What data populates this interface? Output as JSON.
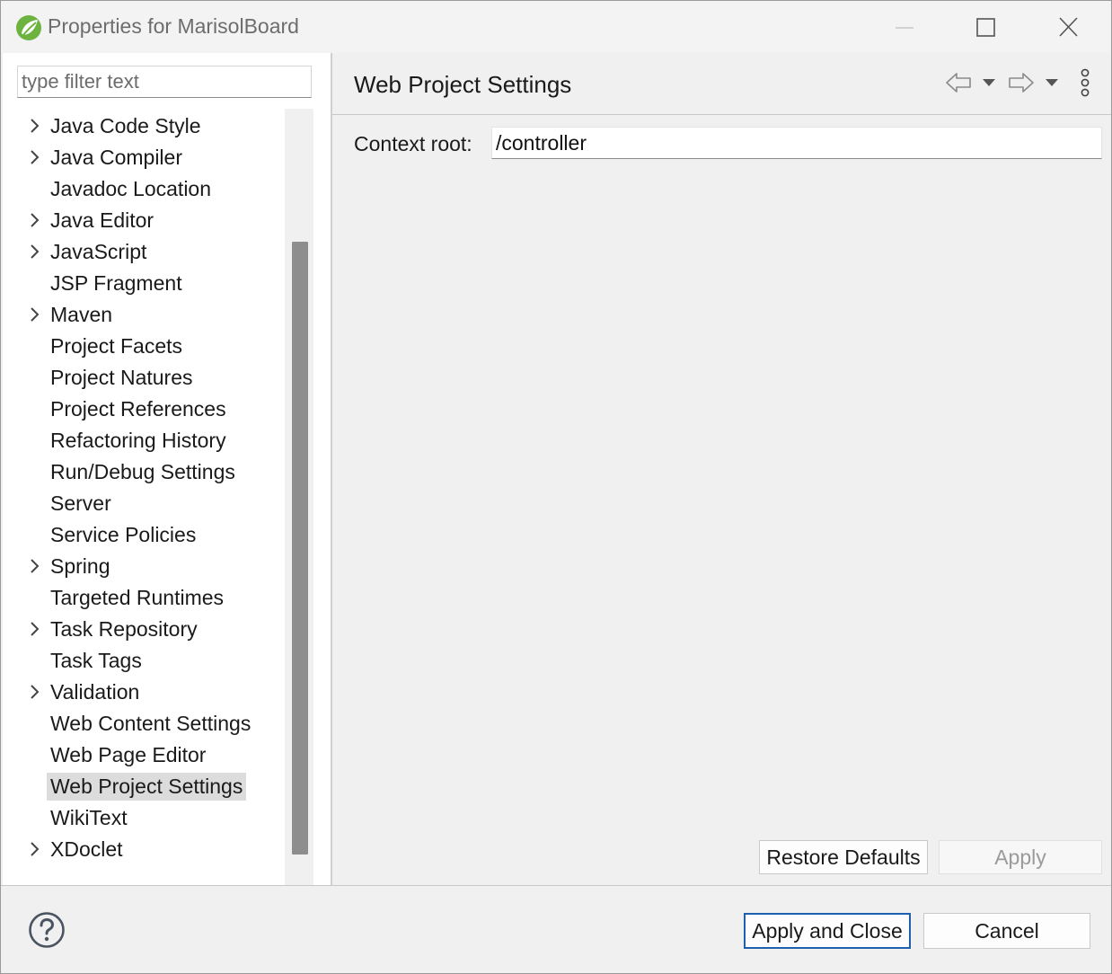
{
  "window": {
    "title": "Properties for MarisolBoard",
    "icon": "spring-leaf-icon",
    "controls": [
      "minimize-icon",
      "maximize-icon",
      "close-icon"
    ]
  },
  "filter": {
    "placeholder": "type filter text",
    "value": ""
  },
  "tree": {
    "items": [
      {
        "label": "Java Code Style",
        "expandable": true
      },
      {
        "label": "Java Compiler",
        "expandable": true
      },
      {
        "label": "Javadoc Location",
        "expandable": false
      },
      {
        "label": "Java Editor",
        "expandable": true
      },
      {
        "label": "JavaScript",
        "expandable": true
      },
      {
        "label": "JSP Fragment",
        "expandable": false
      },
      {
        "label": "Maven",
        "expandable": true
      },
      {
        "label": "Project Facets",
        "expandable": false
      },
      {
        "label": "Project Natures",
        "expandable": false
      },
      {
        "label": "Project References",
        "expandable": false
      },
      {
        "label": "Refactoring History",
        "expandable": false
      },
      {
        "label": "Run/Debug Settings",
        "expandable": false
      },
      {
        "label": "Server",
        "expandable": false
      },
      {
        "label": "Service Policies",
        "expandable": false
      },
      {
        "label": "Spring",
        "expandable": true
      },
      {
        "label": "Targeted Runtimes",
        "expandable": false
      },
      {
        "label": "Task Repository",
        "expandable": true
      },
      {
        "label": "Task Tags",
        "expandable": false
      },
      {
        "label": "Validation",
        "expandable": true
      },
      {
        "label": "Web Content Settings",
        "expandable": false
      },
      {
        "label": "Web Page Editor",
        "expandable": false
      },
      {
        "label": "Web Project Settings",
        "expandable": false,
        "selected": true
      },
      {
        "label": "WikiText",
        "expandable": false
      },
      {
        "label": "XDoclet",
        "expandable": true
      }
    ]
  },
  "page": {
    "title": "Web Project Settings",
    "nav_icons": [
      "back-arrow-icon",
      "back-dropdown-icon",
      "forward-arrow-icon",
      "forward-dropdown-icon",
      "kebab-menu-icon"
    ],
    "context_root_label": "Context root:",
    "context_root_value": "/controller",
    "restore_defaults_label": "Restore Defaults",
    "apply_label": "Apply"
  },
  "footer": {
    "help_icon": "help-icon",
    "apply_close_label": "Apply and Close",
    "cancel_label": "Cancel"
  },
  "colors": {
    "selection_bg": "#dcdcdc",
    "primary_border": "#1f5fb0",
    "leaf_green": "#6db33f"
  }
}
